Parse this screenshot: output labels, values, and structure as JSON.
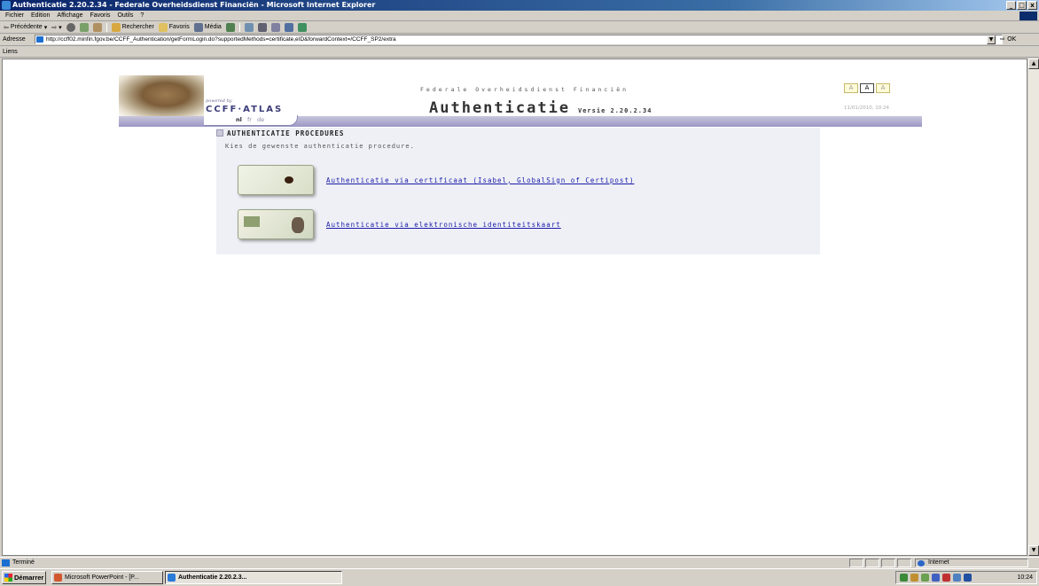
{
  "window": {
    "title": "Authenticatie 2.20.2.34 - Federale Overheidsdienst Financiën - Microsoft Internet Explorer",
    "minimize": "_",
    "maximize": "□",
    "close": "x"
  },
  "menu": [
    "Fichier",
    "Edition",
    "Affichage",
    "Favoris",
    "Outils",
    "?"
  ],
  "toolbar": {
    "back": "Précédente",
    "search": "Rechercher",
    "favorites": "Favoris",
    "media": "Média"
  },
  "address": {
    "label": "Adresse",
    "url": "http://ccff02.minfin.fgov.be/CCFF_Authentication/getFormLogin.do?supportedMethods=certificate,eID&forwardContext=/CCFF_SP2/extra",
    "go": "OK"
  },
  "links_bar": {
    "label": "Liens"
  },
  "page": {
    "powered_by": "powered by",
    "brand": "CCFF·ATLAS",
    "org": "Federale Overheidsdienst Financiën",
    "title": "Authenticatie",
    "version": "Versie 2.20.2.34",
    "font_sizes": [
      "A",
      "A",
      "A"
    ],
    "datetime": "11/01/2010, 10:24",
    "languages": {
      "active": "nl",
      "others": [
        "fr",
        "de"
      ]
    },
    "section_title": "AUTHENTICATIE PROCEDURES",
    "instruction": "Kies de gewenste authenticatie procedure.",
    "options": [
      {
        "label": "Authenticatie via certificaat (Isabel, GlobalSign of Certipost)",
        "icon": "certificate-card-icon"
      },
      {
        "label": "Authenticatie via elektronische identiteitskaart",
        "icon": "eid-card-icon"
      }
    ]
  },
  "statusbar": {
    "text": "Terminé",
    "zone": "Internet"
  },
  "taskbar": {
    "start": "Démarrer",
    "tasks": [
      "Microsoft PowerPoint - [P...",
      "Authenticatie 2.20.2.3..."
    ],
    "clock": "10:24"
  }
}
